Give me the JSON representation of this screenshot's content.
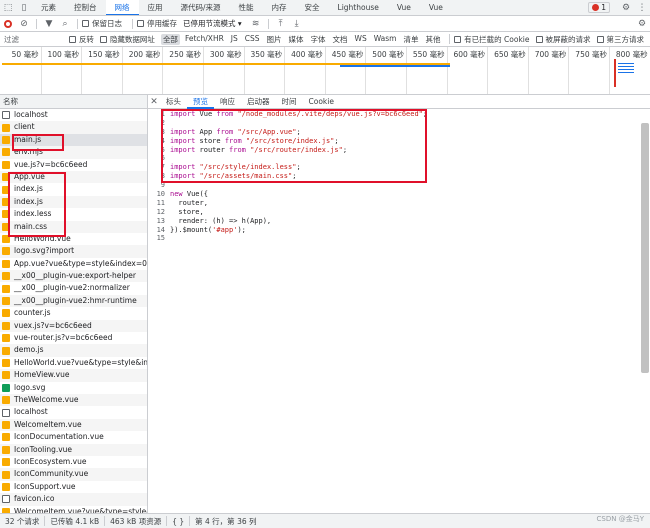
{
  "top_tabs": [
    "元素",
    "控制台",
    "网络",
    "应用",
    "源代码/来源",
    "性能",
    "内存",
    "安全",
    "Lighthouse",
    "Vue",
    "Vue"
  ],
  "top_selected": 2,
  "error_badge": "1",
  "toolbar": {
    "preserve_log": "保留日志",
    "disable_cache": "停用缓存",
    "throttle": "已停用节流模式"
  },
  "filter": {
    "label": "过滤",
    "invert": "反转",
    "hide_data": "隐藏数据网址",
    "types": [
      "全部",
      "Fetch/XHR",
      "JS",
      "CSS",
      "图片",
      "媒体",
      "字体",
      "文档",
      "WS",
      "Wasm",
      "清单",
      "其他"
    ],
    "blocked_cookie": "有已拦截的 Cookie",
    "blocked_req": "被屏蔽的请求",
    "third_party": "第三方请求"
  },
  "timeline_ticks": [
    "50 毫秒",
    "100 毫秒",
    "150 毫秒",
    "200 毫秒",
    "250 毫秒",
    "300 毫秒",
    "350 毫秒",
    "400 毫秒",
    "450 毫秒",
    "500 毫秒",
    "550 毫秒",
    "600 毫秒",
    "650 毫秒",
    "700 毫秒",
    "750 毫秒",
    "800 毫秒"
  ],
  "list_header": "名称",
  "files": [
    {
      "name": "localhost",
      "type": "doc"
    },
    {
      "name": "client",
      "type": "js"
    },
    {
      "name": "main.js",
      "type": "js",
      "selected": true
    },
    {
      "name": "env.mjs",
      "type": "js"
    },
    {
      "name": "vue.js?v=bc6c6eed",
      "type": "js"
    },
    {
      "name": "App.vue",
      "type": "js"
    },
    {
      "name": "index.js",
      "type": "js"
    },
    {
      "name": "index.js",
      "type": "js"
    },
    {
      "name": "index.less",
      "type": "js"
    },
    {
      "name": "main.css",
      "type": "js"
    },
    {
      "name": "HelloWorld.vue",
      "type": "js"
    },
    {
      "name": "logo.svg?import",
      "type": "js"
    },
    {
      "name": "App.vue?vue&type=style&index=0&sc...",
      "type": "js"
    },
    {
      "name": "__x00__plugin-vue:export-helper",
      "type": "js"
    },
    {
      "name": "__x00__plugin-vue2:normalizer",
      "type": "js"
    },
    {
      "name": "__x00__plugin-vue2:hmr-runtime",
      "type": "js"
    },
    {
      "name": "counter.js",
      "type": "js"
    },
    {
      "name": "vuex.js?v=bc6c6eed",
      "type": "js"
    },
    {
      "name": "vue-router.js?v=bc6c6eed",
      "type": "js"
    },
    {
      "name": "demo.js",
      "type": "js"
    },
    {
      "name": "HelloWorld.vue?vue&type=style&index...",
      "type": "js"
    },
    {
      "name": "HomeView.vue",
      "type": "js"
    },
    {
      "name": "logo.svg",
      "type": "img"
    },
    {
      "name": "TheWelcome.vue",
      "type": "js"
    },
    {
      "name": "localhost",
      "type": "doc"
    },
    {
      "name": "WelcomeItem.vue",
      "type": "js"
    },
    {
      "name": "IconDocumentation.vue",
      "type": "js"
    },
    {
      "name": "IconTooling.vue",
      "type": "js"
    },
    {
      "name": "IconEcosystem.vue",
      "type": "js"
    },
    {
      "name": "IconCommunity.vue",
      "type": "js"
    },
    {
      "name": "IconSupport.vue",
      "type": "js"
    },
    {
      "name": "favicon.ico",
      "type": "doc"
    },
    {
      "name": "WelcomeItem.vue?vue&type=style&ind...",
      "type": "js"
    }
  ],
  "detail_tabs": [
    "标头",
    "预览",
    "响应",
    "启动器",
    "时间",
    "Cookie"
  ],
  "detail_selected": 1,
  "code_lines": [
    "import Vue from \"/node_modules/.vite/deps/vue.js?v=bc6c6eed\";",
    "",
    "import App from \"/src/App.vue\";",
    "import store from \"/src/store/index.js\";",
    "import router from \"/src/router/index.js\";",
    "",
    "import \"/src/style/index.less\";",
    "import \"/src/assets/main.css\";",
    "",
    "new Vue({",
    "  router,",
    "  store,",
    "  render: (h) => h(App),",
    "}).$mount('#app');",
    ""
  ],
  "status": {
    "requests": "32 个请求",
    "transferred": "已传输 4.1 kB",
    "resources": "463 kB 项资源",
    "cursor": "第 4 行，第 36 列"
  },
  "watermark": "CSDN @金马Y",
  "colors": {
    "accent": "#1a73e8",
    "highlight": "#e0102a"
  }
}
